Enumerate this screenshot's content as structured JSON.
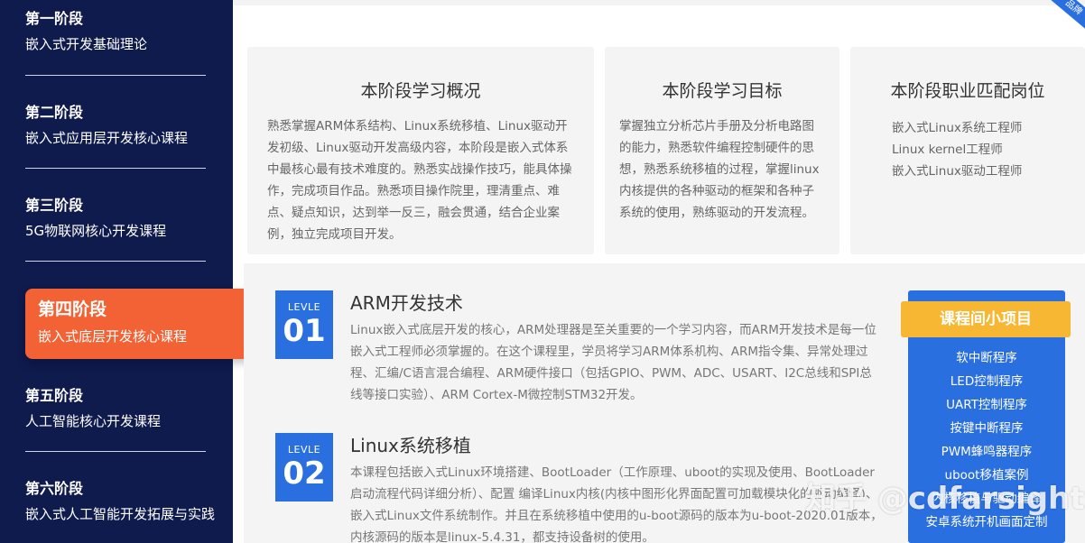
{
  "sidebar": {
    "stages": [
      {
        "title": "第一阶段",
        "subtitle": "嵌入式开发基础理论"
      },
      {
        "title": "第二阶段",
        "subtitle": "嵌入式应用层开发核心课程"
      },
      {
        "title": "第三阶段",
        "subtitle": "5G物联网核心开发课程"
      },
      {
        "title": "第四阶段",
        "subtitle": "嵌入式底层开发核心课程"
      },
      {
        "title": "第五阶段",
        "subtitle": "人工智能核心开发课程"
      },
      {
        "title": "第六阶段",
        "subtitle": "嵌入式人工智能开发拓展与实践"
      }
    ],
    "active_index": 3
  },
  "ribbon_text": "品牌",
  "cards": {
    "overview": {
      "title": "本阶段学习概况",
      "text": "熟悉掌握ARM体系结构、Linux系统移植、Linux驱动开发初级、Linux驱动开发高级内容，本阶段是嵌入式体系中最核心最有技术难度的。熟悉实战操作技巧，能具体操作，完成项目作品。熟悉项目操作院里，理清重点、难点、疑点知识，达到举一反三，融会贯通，结合企业案例，独立完成项目开发。"
    },
    "goal": {
      "title": "本阶段学习目标",
      "text": "掌握独立分析芯片手册及分析电路图的能力，熟悉软件编程控制硬件的思想，熟悉系统移植的过程，掌握linux内核提供的各种驱动的框架和各种子系统的使用，熟练驱动的开发流程。"
    },
    "jobs": {
      "title": "本阶段职业匹配岗位",
      "items": [
        "嵌入式Linux系统工程师",
        "Linux kernel工程师",
        "嵌入式Linux驱动工程师"
      ]
    }
  },
  "courses": [
    {
      "level_label": "LEVLE",
      "level_num": "01",
      "title": "ARM开发技术",
      "desc": "Linux嵌入式底层开发的核心，ARM处理器是至关重要的一个学习内容，而ARM开发技术是每一位嵌入式工程师必须掌握的。在这个课程里，学员将学习ARM体系机构、ARM指令集、异常处理过程、汇编/C语言混合编程、ARM硬件接口（包括GPIO、PWM、ADC、USART、I2C总线和SPI总线等接口实验）、ARM Cortex-M微控制STM32开发。"
    },
    {
      "level_label": "LEVLE",
      "level_num": "02",
      "title": "Linux系统移植",
      "desc": "本课程包括嵌入式Linux环境搭建、BootLoader（工作原理、uboot的实现及使用、BootLoader启动流程代码详细分析）、配置 编译Linux内核(内核中图形化界面配置可加载模块化的驱动编译)、嵌入式Linux文件系统制作。并且在系统移植中使用的u-boot源码的版本为u-boot-2020.01版本，内核源码的版本是linux-5.4.31，都支持设备树的使用。"
    }
  ],
  "projects": {
    "header": "课程间小项目",
    "items": [
      "软中断程序",
      "LED控制程序",
      "UART控制程序",
      "按键中断程序",
      "PWM蜂鸣器程序",
      "uboot移植案例",
      "内核移植与驱动编译",
      "安卓系统开机画面定制"
    ]
  },
  "watermark": "知乎 @cdfarsight"
}
